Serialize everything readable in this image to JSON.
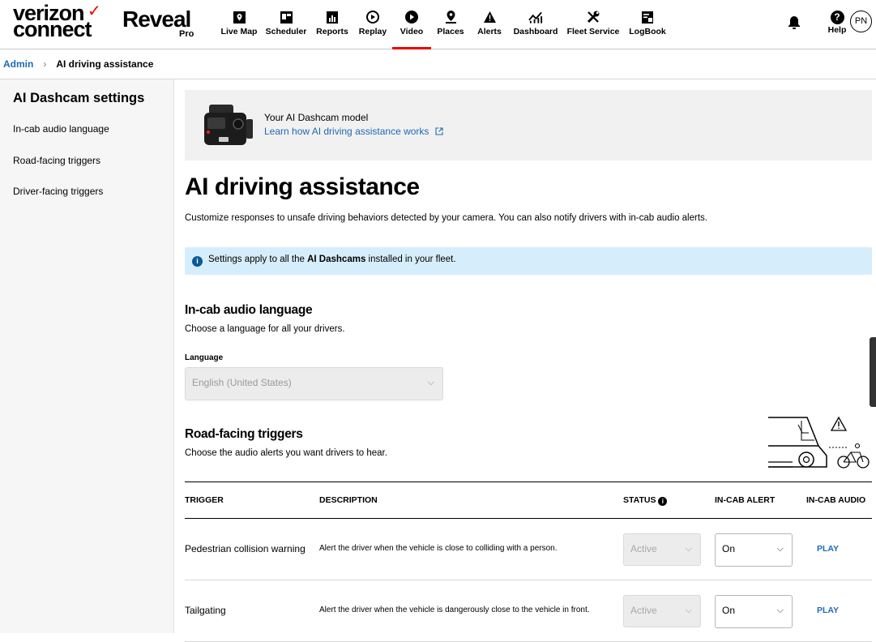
{
  "brand": {
    "vz_line1": "verizon",
    "vz_line2": "connect",
    "vz_check": "✓",
    "product": "Reveal",
    "edition": "Pro"
  },
  "nav": [
    {
      "label": "Live Map",
      "icon": "map-icon"
    },
    {
      "label": "Scheduler",
      "icon": "scheduler-icon"
    },
    {
      "label": "Reports",
      "icon": "reports-icon"
    },
    {
      "label": "Replay",
      "icon": "replay-icon"
    },
    {
      "label": "Video",
      "icon": "video-icon",
      "active": true
    },
    {
      "label": "Places",
      "icon": "places-icon"
    },
    {
      "label": "Alerts",
      "icon": "alert-icon"
    },
    {
      "label": "Dashboard",
      "icon": "dashboard-icon"
    },
    {
      "label": "Fleet Service",
      "icon": "wrench-icon"
    },
    {
      "label": "LogBook",
      "icon": "logbook-icon"
    }
  ],
  "header_right": {
    "help_label": "Help",
    "help_glyph": "?",
    "avatar_initials": "PN"
  },
  "breadcrumb": {
    "root": "Admin",
    "current": "AI driving assistance"
  },
  "sidebar": {
    "title": "AI Dashcam settings",
    "items": [
      "In-cab audio language",
      "Road-facing triggers",
      "Driver-facing triggers"
    ]
  },
  "model": {
    "title": "Your AI Dashcam model",
    "link": "Learn how AI driving assistance works"
  },
  "page": {
    "title": "AI driving assistance",
    "intro": "Customize responses to unsafe driving behaviors detected by your camera. You can also notify drivers with in-cab audio alerts."
  },
  "info": {
    "pre": "Settings apply to all the ",
    "bold": "AI Dashcams",
    "post": " installed in your fleet."
  },
  "audio_language": {
    "title": "In-cab audio language",
    "subtitle": "Choose a language for all your drivers.",
    "field_label": "Language",
    "value": "English (United States)"
  },
  "road_facing": {
    "title": "Road-facing triggers",
    "subtitle": "Choose the audio alerts you want drivers to hear.",
    "columns": {
      "trigger": "TRIGGER",
      "description": "DESCRIPTION",
      "status": "STATUS",
      "in_cab_alert": "IN-CAB ALERT",
      "in_cab_audio": "IN-CAB AUDIO"
    },
    "rows": [
      {
        "trigger": "Pedestrian collision warning",
        "description": "Alert the driver when the vehicle is close to colliding with a person.",
        "status": "Active",
        "alert": "On",
        "audio": "PLAY"
      },
      {
        "trigger": "Tailgating",
        "description": "Alert the driver when the vehicle is dangerously close to the vehicle in front.",
        "status": "Active",
        "alert": "On",
        "audio": "PLAY"
      }
    ]
  },
  "colors": {
    "accent_red": "#ee0000",
    "link_blue": "#1d6ab5",
    "info_bg": "#d6eefb"
  }
}
